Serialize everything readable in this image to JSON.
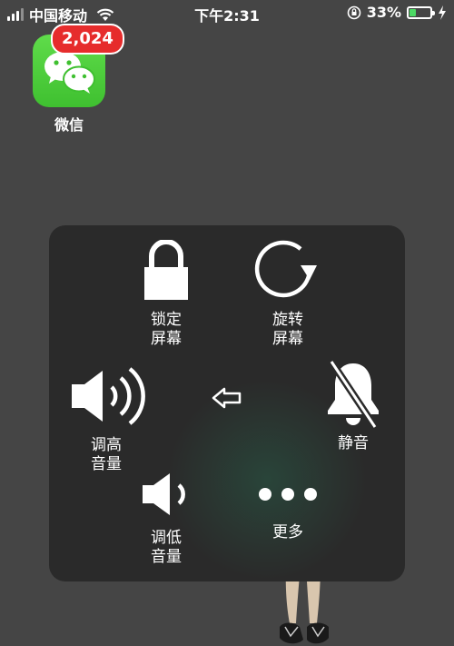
{
  "status_bar": {
    "carrier": "中国移动",
    "time": "下午2:31",
    "battery_percent": "33%",
    "battery_level": 0.33,
    "battery_color": "#4cd964"
  },
  "home": {
    "app_label": "微信",
    "badge": "2,024",
    "badge_color": "#e62c2c"
  },
  "assistive_menu": {
    "lock_screen": {
      "line1": "锁定",
      "line2": "屏幕",
      "icon": "lock-icon"
    },
    "rotate_screen": {
      "line1": "旋转",
      "line2": "屏幕",
      "icon": "rotate-icon"
    },
    "volume_up": {
      "line1": "调高",
      "line2": "音量",
      "icon": "speaker-loud-icon"
    },
    "back": {
      "icon": "back-arrow-icon"
    },
    "mute": {
      "line1": "静音",
      "icon": "bell-slash-icon"
    },
    "volume_down": {
      "line1": "调低",
      "line2": "音量",
      "icon": "speaker-low-icon"
    },
    "more": {
      "line1": "更多",
      "icon": "more-dots-icon"
    }
  }
}
